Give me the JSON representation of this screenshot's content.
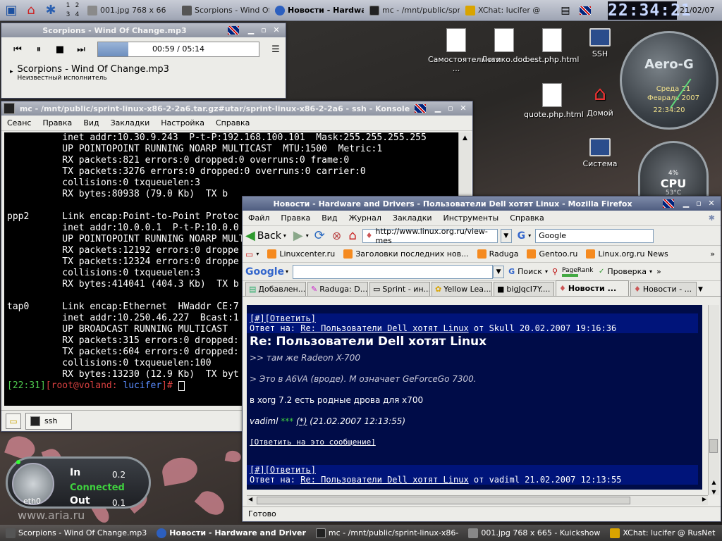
{
  "top_panel": {
    "pager": [
      "1",
      "2",
      "3",
      "4"
    ],
    "tasks": [
      {
        "label": "001.jpg 768 x 66",
        "active": false
      },
      {
        "label": "Scorpions - Wind Of C",
        "active": false
      },
      {
        "label": "Новости - Hardwa",
        "active": true
      },
      {
        "label": "mc - /mnt/public/spri",
        "active": false
      },
      {
        "label": "XChat: lucifer @",
        "active": false
      }
    ],
    "clock": "22:34:21",
    "date": "21/02/07"
  },
  "player": {
    "title": "Scorpions - Wind Of Change.mp3",
    "time": "00:59 / 05:14",
    "progress": 0.19,
    "track": "Scorpions - Wind Of Change.mp3",
    "artist": "Неизвестный исполнитель"
  },
  "konsole": {
    "title": "mc - /mnt/public/sprint-linux-x86-2-2a6.tar.gz#utar/sprint-linux-x86-2-2a6 - ssh - Konsole",
    "menu": [
      "Сеанс",
      "Правка",
      "Вид",
      "Закладки",
      "Настройка",
      "Справка"
    ],
    "lines": [
      "          inet addr:10.30.9.243  P-t-P:192.168.100.101  Mask:255.255.255.255",
      "          UP POINTOPOINT RUNNING NOARP MULTICAST  MTU:1500  Metric:1",
      "          RX packets:821 errors:0 dropped:0 overruns:0 frame:0",
      "          TX packets:3276 errors:0 dropped:0 overruns:0 carrier:0",
      "          collisions:0 txqueuelen:3",
      "          RX bytes:80938 (79.0 Kb)  TX b",
      "",
      "ppp2      Link encap:Point-to-Point Protoc",
      "          inet addr:10.0.0.1  P-t-P:10.0.0",
      "          UP POINTOPOINT RUNNING NOARP MULT",
      "          RX packets:12192 errors:0 droppe",
      "          TX packets:12324 errors:0 droppe",
      "          collisions:0 txqueuelen:3",
      "          RX bytes:414041 (404.3 Kb)  TX b",
      "",
      "tap0      Link encap:Ethernet  HWaddr CE:7",
      "          inet addr:10.250.46.227  Bcast:1",
      "          UP BROADCAST RUNNING MULTICAST",
      "          RX packets:315 errors:0 dropped:",
      "          TX packets:604 errors:0 dropped:",
      "          collisions:0 txqueuelen:100",
      "          RX bytes:13230 (12.9 Kb)  TX byt"
    ],
    "prompt_time": "[22:31]",
    "prompt_user": "[root@voland:",
    "prompt_dir": " lucifer",
    "prompt_end": "]# ",
    "session_tab": "ssh"
  },
  "desktop_icons": [
    {
      "label": "Самостоятельная ..."
    },
    {
      "label": "Логико.doc"
    },
    {
      "label": "best.php.html"
    },
    {
      "label": "SSH"
    },
    {
      "label": "quote.php.html"
    },
    {
      "label": "Домой"
    },
    {
      "label": "Система"
    }
  ],
  "widgets": {
    "clock_brand": "Aero-G",
    "clock_date": "Среда 21 Февраль 2007",
    "clock_time": "22:34:20",
    "cpu_percent": "4%",
    "cpu_label": "CPU",
    "cpu_temp": "53°C",
    "net_in_label": "In",
    "net_in_value": "0.2",
    "net_status": "Connected",
    "net_out_label": "Out",
    "net_out_value": "0.1",
    "net_iface": "eth0",
    "watermark": "www.aria.ru"
  },
  "firefox": {
    "title": "Новости - Hardware and Drivers - Пользователи Dell хотят Linux - Mozilla Firefox",
    "menu": [
      "Файл",
      "Правка",
      "Вид",
      "Журнал",
      "Закладки",
      "Инструменты",
      "Справка"
    ],
    "back_label": "Back",
    "url": "http://www.linux.org.ru/view-mes",
    "search_value": "Google",
    "bookmarks": [
      "Linuxcenter.ru",
      "Заголовки последних нов...",
      "Raduga",
      "Gentoo.ru",
      "Linux.org.ru News"
    ],
    "google_bar": {
      "logo": "Google",
      "search_btn": "Поиск",
      "pagerank": "PageRank",
      "check": "Проверка"
    },
    "tabs": [
      {
        "label": "Добавлен...",
        "active": false
      },
      {
        "label": "Raduga: D...",
        "active": false
      },
      {
        "label": "Sprint - ин...",
        "active": false
      },
      {
        "label": "Yellow Lea...",
        "active": false
      },
      {
        "label": "bigJqcI7Y....",
        "active": false
      },
      {
        "label": "Новости ...",
        "active": true
      },
      {
        "label": "Новости - ...",
        "active": false
      }
    ],
    "post1": {
      "links": "[#][Ответить]",
      "reply_prefix": "Ответ на: ",
      "reply_link": "Re: Пользователи Dell хотят Linux",
      "reply_meta": " от Skull 20.02.2007 19:16:36",
      "heading": "Re: Пользователи Dell хотят Linux",
      "quote1": ">> там же Radeon X-700",
      "quote2": "> Это в A6VA (вроде). M означает GeForceGo 7300.",
      "body": "в xorg 7.2 есть родные дрова для x700",
      "author": "vadiml",
      "stars": "***",
      "star_link": "(*)",
      "date": " (21.02.2007 12:13:55)",
      "reply_this": "[Ответить на это сообщение]"
    },
    "post2": {
      "links": "[#][Ответить]",
      "reply_prefix": "Ответ на: ",
      "reply_link": "Re: Пользователи Dell хотят Linux",
      "reply_meta": " от vadiml 21.02.2007 12:13:55"
    },
    "status": "Готово"
  },
  "bottom_panel": {
    "tasks": [
      {
        "label": "Scorpions - Wind Of Change.mp3",
        "active": false
      },
      {
        "label": "Новости - Hardware and Driver",
        "active": true
      },
      {
        "label": "mc - /mnt/public/sprint-linux-x86-",
        "active": false
      },
      {
        "label": "001.jpg 768 x 665 - Kuickshow",
        "active": false
      },
      {
        "label": "XChat: lucifer @ RusNet",
        "active": false
      }
    ]
  }
}
